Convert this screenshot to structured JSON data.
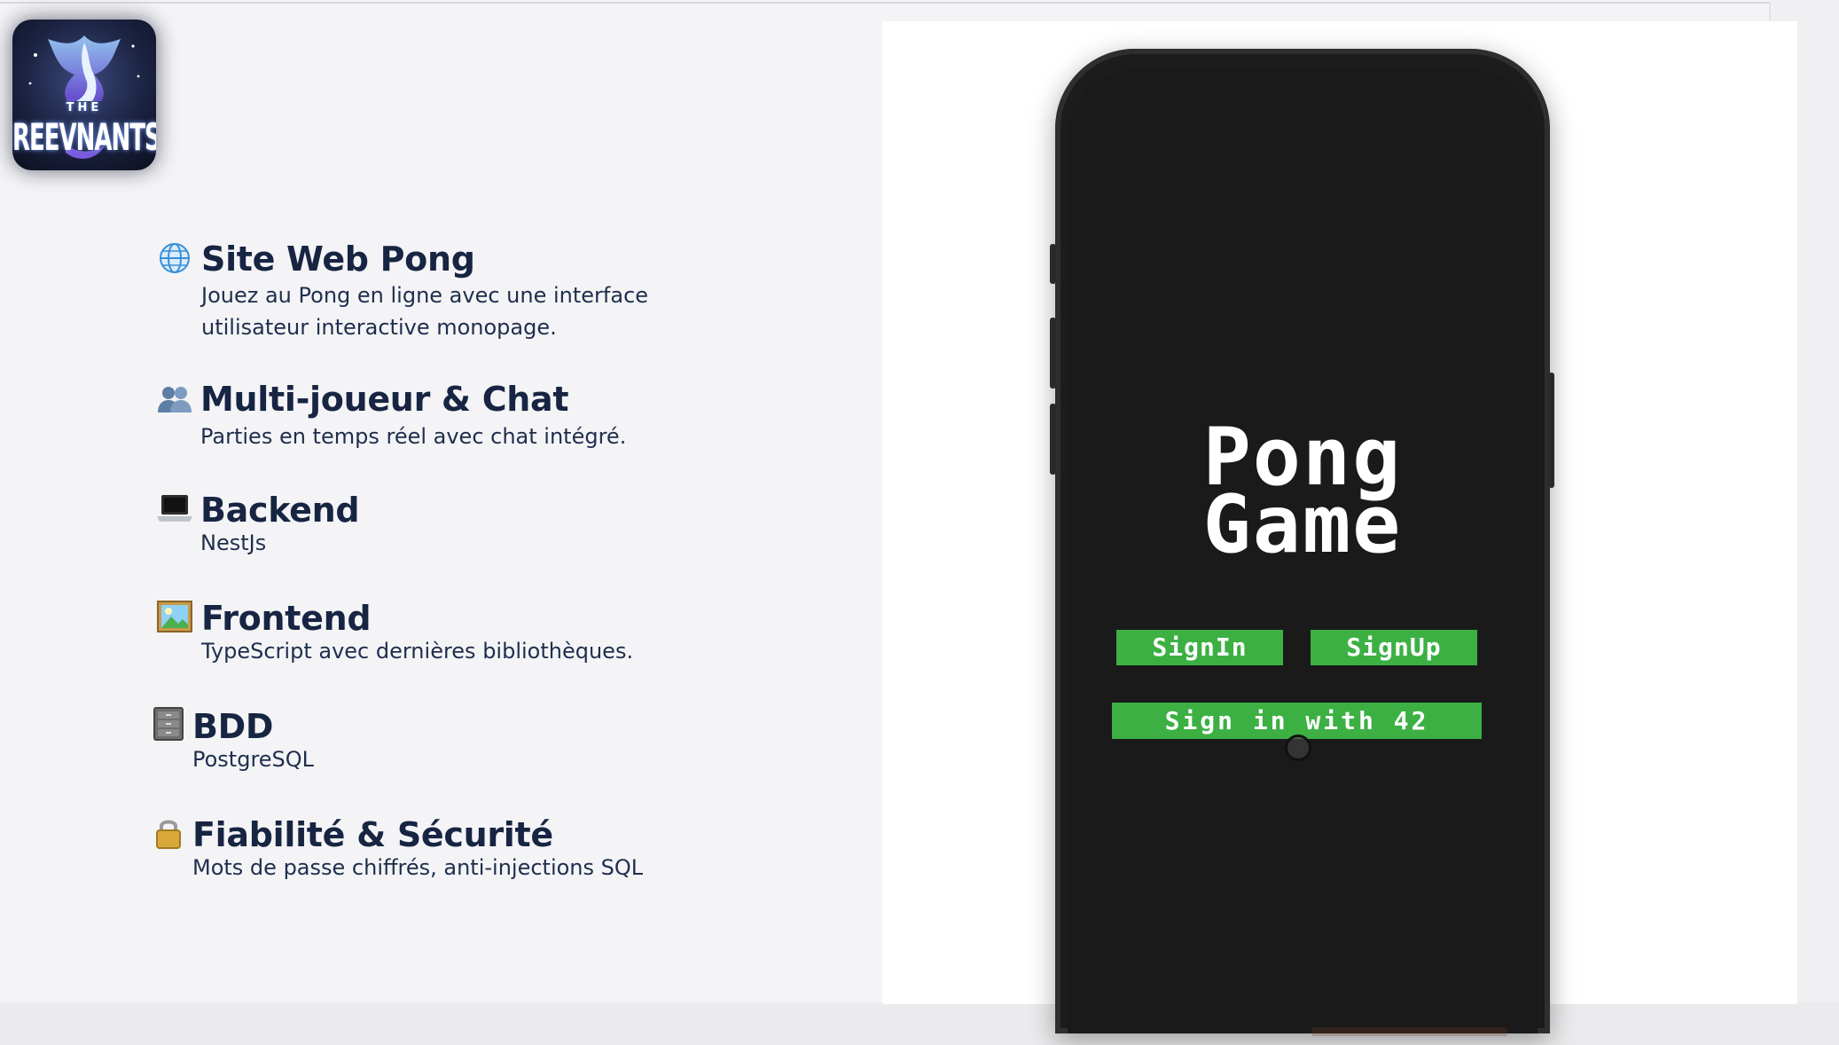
{
  "logo": {
    "line1": "THE",
    "line2": "REEVNANTS"
  },
  "features": [
    {
      "icon": "globe-icon",
      "title": "Site Web Pong",
      "desc": [
        "Jouez au Pong en ligne avec une interface",
        "utilisateur interactive monopage."
      ]
    },
    {
      "icon": "people-icon",
      "title": "Multi-joueur & Chat",
      "desc": [
        "Parties en temps réel avec chat intégré."
      ]
    },
    {
      "icon": "laptop-icon",
      "title": "Backend",
      "desc": [
        "NestJs"
      ]
    },
    {
      "icon": "picture-icon",
      "title": "Frontend",
      "desc": [
        "TypeScript avec dernières bibliothèques."
      ]
    },
    {
      "icon": "file-cabinet-icon",
      "title": "BDD",
      "desc": [
        "PostgreSQL"
      ]
    },
    {
      "icon": "lock-icon",
      "title": "Fiabilité & Sécurité",
      "desc": [
        "Mots de passe chiffrés, anti-injections SQL"
      ]
    }
  ],
  "phone": {
    "title_line1": "Pong",
    "title_line2": "Game",
    "signin_label": "SignIn",
    "signup_label": "SignUp",
    "sign42_label": "Sign in with 42",
    "button_color": "#3cb043"
  }
}
